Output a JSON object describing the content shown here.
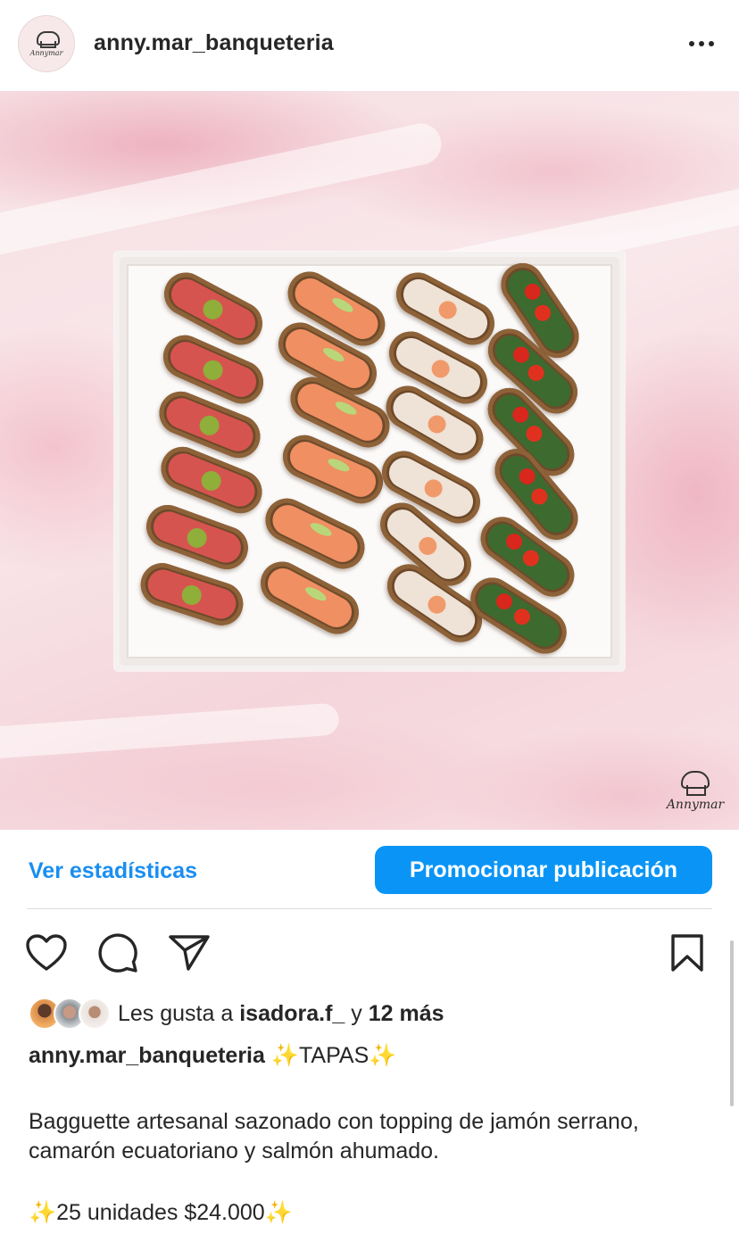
{
  "header": {
    "username": "anny.mar_banqueteria",
    "avatar_text": "Annymar"
  },
  "post": {
    "watermark_text": "Annymar"
  },
  "actions": {
    "stats_label": "Ver estadísticas",
    "promote_label": "Promocionar publicación"
  },
  "likes": {
    "prefix": "Les gusta a",
    "user": "isadora.f_",
    "joiner": "y",
    "others": "12 más"
  },
  "caption": {
    "author": "anny.mar_banqueteria",
    "sparkle": "✨",
    "title": "TAPAS",
    "body": "Bagguette artesanal sazonado con topping de jamón serrano, camarón ecuatoriano y salmón ahumado.",
    "price": "25 unidades $24.000"
  },
  "colors": {
    "link_blue": "#1a8ef0",
    "button_blue": "#0a95f6",
    "text": "#262626"
  },
  "icons": [
    "more-icon",
    "heart-icon",
    "comment-icon",
    "share-icon",
    "bookmark-icon"
  ]
}
